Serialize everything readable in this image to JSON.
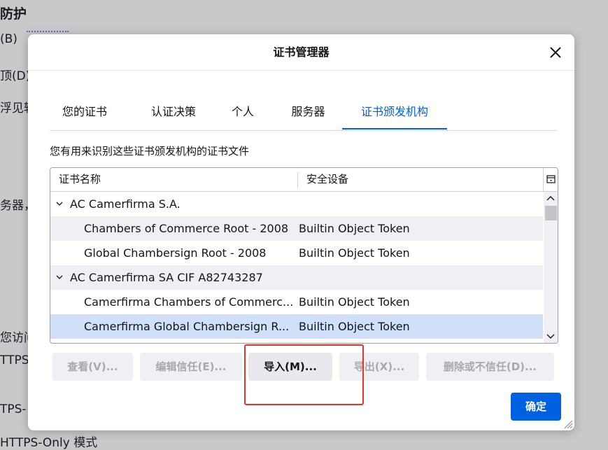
{
  "background": {
    "lines": [
      "防护",
      "(B)",
      "顶(D)",
      "浮见较",
      "务器，",
      "您访问",
      "TTPS",
      "TPS-",
      "HTTPS-Only 模式"
    ]
  },
  "dialog": {
    "title": "证书管理器",
    "tabs": [
      {
        "label": "您的证书"
      },
      {
        "label": "认证决策"
      },
      {
        "label": "个人"
      },
      {
        "label": "服务器"
      },
      {
        "label": "证书颁发机构",
        "active": true
      }
    ],
    "description": "您有用来识别这些证书颁发机构的证书文件",
    "tree": {
      "columns": {
        "name": "证书名称",
        "device": "安全设备"
      },
      "rows": [
        {
          "type": "group",
          "name": "AC Camerfirma S.A.",
          "device": ""
        },
        {
          "type": "item",
          "name": "Chambers of Commerce Root - 2008",
          "device": "Builtin Object Token"
        },
        {
          "type": "item",
          "name": "Global Chambersign Root - 2008",
          "device": "Builtin Object Token"
        },
        {
          "type": "group",
          "name": "AC Camerfirma SA CIF A82743287",
          "device": ""
        },
        {
          "type": "item",
          "name": "Camerfirma Chambers of Commerc...",
          "device": "Builtin Object Token"
        },
        {
          "type": "item",
          "name": "Camerfirma Global Chambersign R...",
          "device": "Builtin Object Token",
          "selected": true
        }
      ]
    },
    "buttons": {
      "view": "查看(V)...",
      "edit_trust": "编辑信任(E)...",
      "import": "导入(M)...",
      "export": "导出(X)...",
      "delete": "删除或不信任(D)...",
      "ok": "确定"
    },
    "colors": {
      "accent": "#0061e0",
      "highlight_box": "#e5332a",
      "selected_row": "#cfe0f8"
    }
  }
}
